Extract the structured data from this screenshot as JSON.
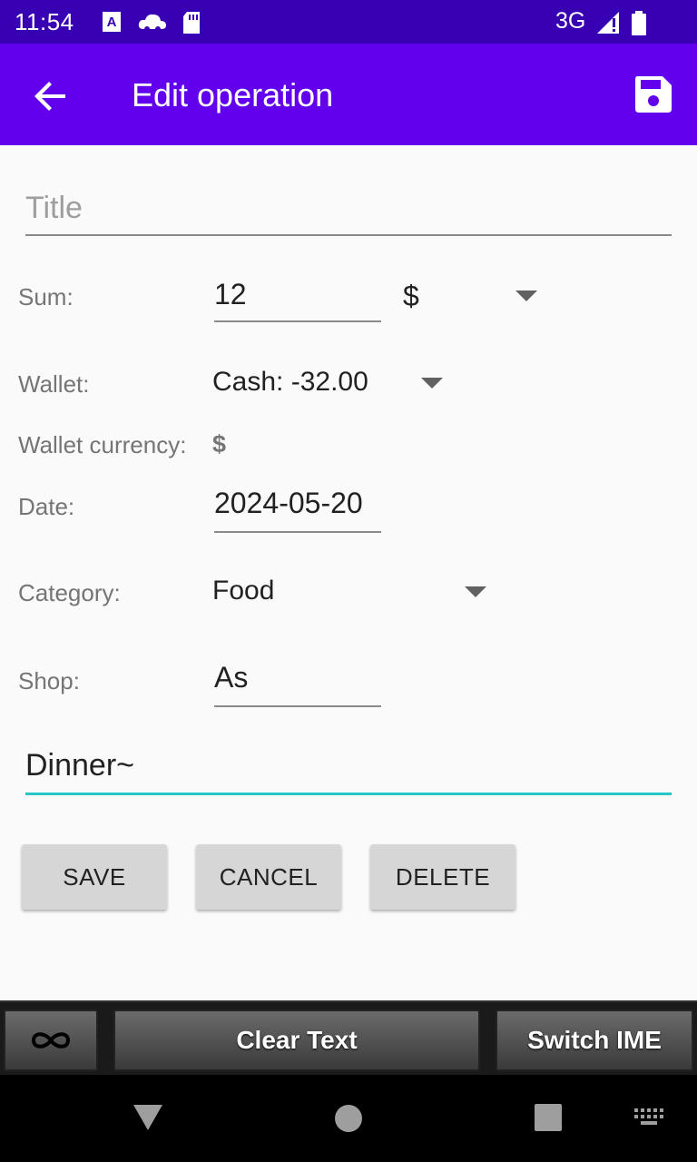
{
  "status_bar": {
    "time": "11:54",
    "network": "3G",
    "icons": [
      "font-a-icon",
      "cloud-icon",
      "sd-card-icon",
      "signal-icon",
      "battery-icon"
    ]
  },
  "app_bar": {
    "title": "Edit operation",
    "back_icon": "arrow-back-icon",
    "save_icon": "save-disk-icon"
  },
  "form": {
    "title_placeholder": "Title",
    "title_value": "",
    "sum_label": "Sum:",
    "sum_value": "12",
    "currency_value": "$",
    "wallet_label": "Wallet:",
    "wallet_value": "Cash: -32.00",
    "wallet_currency_label": "Wallet currency:",
    "wallet_currency_value": "$",
    "date_label": "Date:",
    "date_value": "2024-05-20",
    "category_label": "Category:",
    "category_value": "Food",
    "shop_label": "Shop:",
    "shop_value": "As",
    "note_value": "Dinner~"
  },
  "buttons": {
    "save": "SAVE",
    "cancel": "CANCEL",
    "delete": "DELETE"
  },
  "ime_bar": {
    "infinity_icon": "infinity-icon",
    "clear_text": "Clear Text",
    "switch_ime": "Switch IME"
  },
  "nav_bar": {
    "icons": [
      "back-triangle-icon",
      "home-circle-icon",
      "recents-square-icon",
      "keyboard-icon"
    ]
  },
  "colors": {
    "status_bar": "#3700b3",
    "app_bar": "#6200ee",
    "accent": "#26c6c6"
  }
}
